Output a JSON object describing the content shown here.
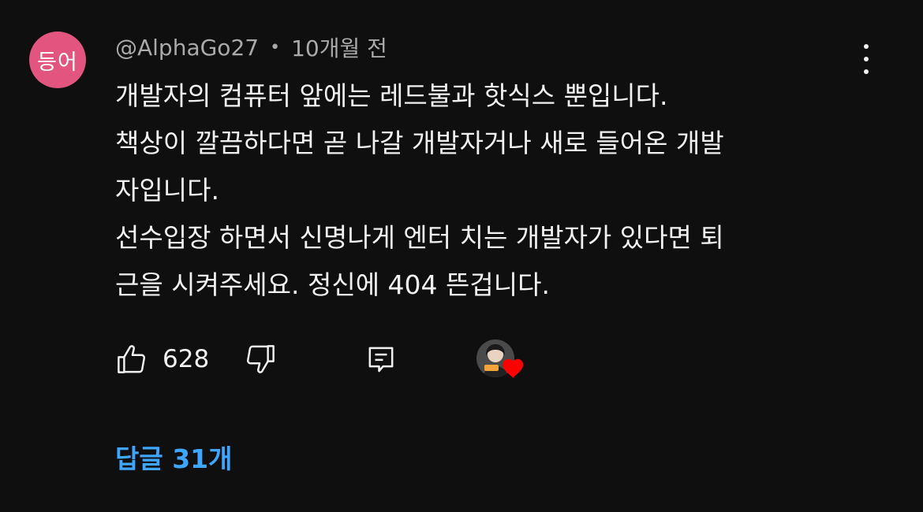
{
  "author": {
    "avatar_text": "등어",
    "avatar_color": "#e2557f",
    "handle": "@AlphaGo27",
    "separator": "•",
    "time_ago": "10개월 전"
  },
  "comment": {
    "lines": [
      "개발자의 컴퓨터 앞에는 레드불과 핫식스 뿐입니다.",
      "책상이 깔끔하다면 곧 나갈 개발자거나 새로 들어온 개발",
      "자입니다.",
      "선수입장 하면서 신명나게 엔터 치는 개발자가 있다면 퇴",
      "근을 시켜주세요. 정신에 404 뜬겁니다."
    ]
  },
  "actions": {
    "like_count": "628",
    "like_icon": "thumbs-up-icon",
    "dislike_icon": "thumbs-down-icon",
    "reply_icon": "reply-comment-icon",
    "creator_heart_icon": "creator-heart-icon",
    "heart_color": "#ff0000"
  },
  "replies": {
    "label": "답글 31개",
    "color": "#3ea6ff"
  },
  "menu": {
    "icon": "more-vertical-icon"
  }
}
